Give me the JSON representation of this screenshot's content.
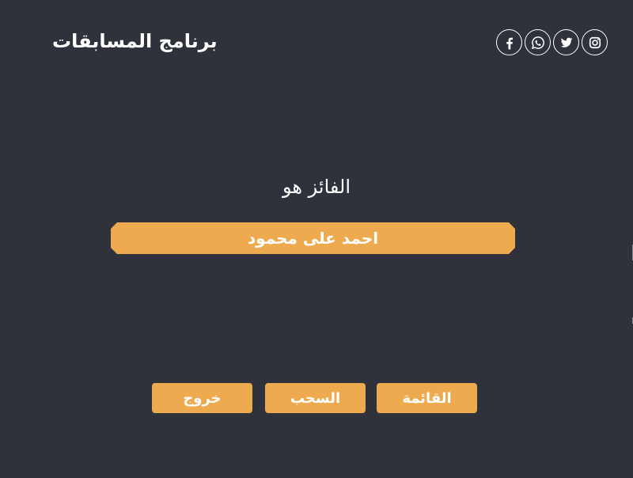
{
  "header": {
    "title": "برنامج المسابقات",
    "social": [
      {
        "name": "facebook",
        "icon": "facebook-icon"
      },
      {
        "name": "whatsapp",
        "icon": "whatsapp-icon"
      },
      {
        "name": "twitter",
        "icon": "twitter-icon"
      },
      {
        "name": "instagram",
        "icon": "instagram-icon"
      }
    ]
  },
  "main": {
    "winner_label": "الفائز هو",
    "winner_name": "احمد على محمود"
  },
  "actions": {
    "exit_label": "خروج",
    "draw_label": "السحب",
    "list_label": "القائمة"
  },
  "colors": {
    "background": "#2f313b",
    "accent": "#eeaa4f",
    "text": "#ffffff"
  }
}
